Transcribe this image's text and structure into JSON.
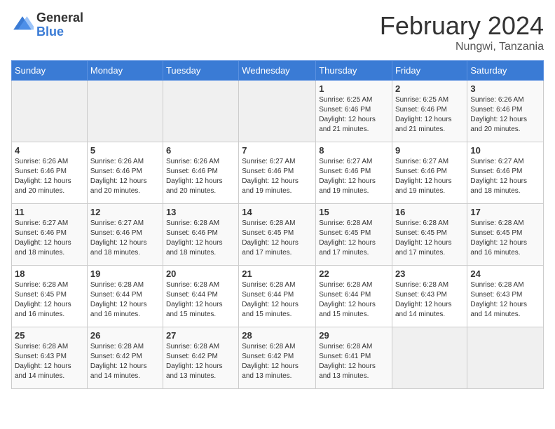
{
  "header": {
    "logo_general": "General",
    "logo_blue": "Blue",
    "month_title": "February 2024",
    "location": "Nungwi, Tanzania"
  },
  "days_of_week": [
    "Sunday",
    "Monday",
    "Tuesday",
    "Wednesday",
    "Thursday",
    "Friday",
    "Saturday"
  ],
  "weeks": [
    [
      {
        "day": "",
        "empty": true
      },
      {
        "day": "",
        "empty": true
      },
      {
        "day": "",
        "empty": true
      },
      {
        "day": "",
        "empty": true
      },
      {
        "day": "1",
        "sunrise": "6:25 AM",
        "sunset": "6:46 PM",
        "daylight": "12 hours and 21 minutes."
      },
      {
        "day": "2",
        "sunrise": "6:25 AM",
        "sunset": "6:46 PM",
        "daylight": "12 hours and 21 minutes."
      },
      {
        "day": "3",
        "sunrise": "6:26 AM",
        "sunset": "6:46 PM",
        "daylight": "12 hours and 20 minutes."
      }
    ],
    [
      {
        "day": "4",
        "sunrise": "6:26 AM",
        "sunset": "6:46 PM",
        "daylight": "12 hours and 20 minutes."
      },
      {
        "day": "5",
        "sunrise": "6:26 AM",
        "sunset": "6:46 PM",
        "daylight": "12 hours and 20 minutes."
      },
      {
        "day": "6",
        "sunrise": "6:26 AM",
        "sunset": "6:46 PM",
        "daylight": "12 hours and 20 minutes."
      },
      {
        "day": "7",
        "sunrise": "6:27 AM",
        "sunset": "6:46 PM",
        "daylight": "12 hours and 19 minutes."
      },
      {
        "day": "8",
        "sunrise": "6:27 AM",
        "sunset": "6:46 PM",
        "daylight": "12 hours and 19 minutes."
      },
      {
        "day": "9",
        "sunrise": "6:27 AM",
        "sunset": "6:46 PM",
        "daylight": "12 hours and 19 minutes."
      },
      {
        "day": "10",
        "sunrise": "6:27 AM",
        "sunset": "6:46 PM",
        "daylight": "12 hours and 18 minutes."
      }
    ],
    [
      {
        "day": "11",
        "sunrise": "6:27 AM",
        "sunset": "6:46 PM",
        "daylight": "12 hours and 18 minutes."
      },
      {
        "day": "12",
        "sunrise": "6:27 AM",
        "sunset": "6:46 PM",
        "daylight": "12 hours and 18 minutes."
      },
      {
        "day": "13",
        "sunrise": "6:28 AM",
        "sunset": "6:46 PM",
        "daylight": "12 hours and 18 minutes."
      },
      {
        "day": "14",
        "sunrise": "6:28 AM",
        "sunset": "6:45 PM",
        "daylight": "12 hours and 17 minutes."
      },
      {
        "day": "15",
        "sunrise": "6:28 AM",
        "sunset": "6:45 PM",
        "daylight": "12 hours and 17 minutes."
      },
      {
        "day": "16",
        "sunrise": "6:28 AM",
        "sunset": "6:45 PM",
        "daylight": "12 hours and 17 minutes."
      },
      {
        "day": "17",
        "sunrise": "6:28 AM",
        "sunset": "6:45 PM",
        "daylight": "12 hours and 16 minutes."
      }
    ],
    [
      {
        "day": "18",
        "sunrise": "6:28 AM",
        "sunset": "6:45 PM",
        "daylight": "12 hours and 16 minutes."
      },
      {
        "day": "19",
        "sunrise": "6:28 AM",
        "sunset": "6:44 PM",
        "daylight": "12 hours and 16 minutes."
      },
      {
        "day": "20",
        "sunrise": "6:28 AM",
        "sunset": "6:44 PM",
        "daylight": "12 hours and 15 minutes."
      },
      {
        "day": "21",
        "sunrise": "6:28 AM",
        "sunset": "6:44 PM",
        "daylight": "12 hours and 15 minutes."
      },
      {
        "day": "22",
        "sunrise": "6:28 AM",
        "sunset": "6:44 PM",
        "daylight": "12 hours and 15 minutes."
      },
      {
        "day": "23",
        "sunrise": "6:28 AM",
        "sunset": "6:43 PM",
        "daylight": "12 hours and 14 minutes."
      },
      {
        "day": "24",
        "sunrise": "6:28 AM",
        "sunset": "6:43 PM",
        "daylight": "12 hours and 14 minutes."
      }
    ],
    [
      {
        "day": "25",
        "sunrise": "6:28 AM",
        "sunset": "6:43 PM",
        "daylight": "12 hours and 14 minutes."
      },
      {
        "day": "26",
        "sunrise": "6:28 AM",
        "sunset": "6:42 PM",
        "daylight": "12 hours and 14 minutes."
      },
      {
        "day": "27",
        "sunrise": "6:28 AM",
        "sunset": "6:42 PM",
        "daylight": "12 hours and 13 minutes."
      },
      {
        "day": "28",
        "sunrise": "6:28 AM",
        "sunset": "6:42 PM",
        "daylight": "12 hours and 13 minutes."
      },
      {
        "day": "29",
        "sunrise": "6:28 AM",
        "sunset": "6:41 PM",
        "daylight": "12 hours and 13 minutes."
      },
      {
        "day": "",
        "empty": true
      },
      {
        "day": "",
        "empty": true
      }
    ]
  ],
  "labels": {
    "sunrise": "Sunrise:",
    "sunset": "Sunset:",
    "daylight": "Daylight:"
  }
}
